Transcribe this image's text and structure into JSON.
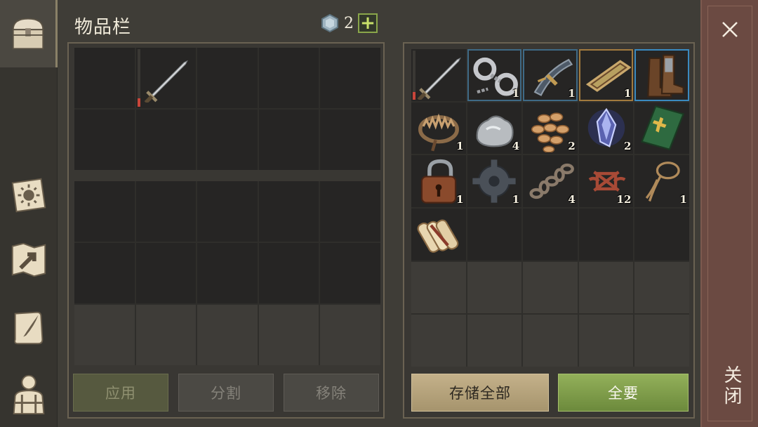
{
  "header": {
    "title": "物品栏",
    "currency_count": "2",
    "plus_label": "+"
  },
  "rail": {
    "tabs": [
      {
        "name": "chest-tab",
        "icon": "chest-icon"
      },
      {
        "name": "skills-tab",
        "icon": "sun-book-icon"
      },
      {
        "name": "map-tab",
        "icon": "map-arrow-icon"
      },
      {
        "name": "quest-tab",
        "icon": "quill-scroll-icon"
      },
      {
        "name": "character-tab",
        "icon": "character-icon"
      }
    ]
  },
  "storage": {
    "items": [
      {
        "icon": "sword-icon",
        "qty": "",
        "durability": 0.15,
        "frame": "none"
      },
      {
        "icon": "shackles-icon",
        "qty": "1",
        "frame": "blue"
      },
      {
        "icon": "crossbow-icon",
        "qty": "1",
        "frame": "blue"
      },
      {
        "icon": "stretcher-icon",
        "qty": "1",
        "frame": "gold"
      },
      {
        "icon": "boots-icon",
        "qty": "",
        "frame": "blue2"
      },
      {
        "icon": "bear-trap-icon",
        "qty": "1",
        "frame": "none"
      },
      {
        "icon": "stone-icon",
        "qty": "4",
        "frame": "none"
      },
      {
        "icon": "seeds-icon",
        "qty": "2",
        "frame": "none"
      },
      {
        "icon": "crystal-icon",
        "qty": "2",
        "frame": "none"
      },
      {
        "icon": "holy-book-icon",
        "qty": "",
        "frame": "none"
      },
      {
        "icon": "padlock-icon",
        "qty": "1",
        "frame": "none"
      },
      {
        "icon": "gear-icon",
        "qty": "1",
        "frame": "none"
      },
      {
        "icon": "chain-icon",
        "qty": "4",
        "frame": "none"
      },
      {
        "icon": "rope-knot-icon",
        "qty": "12",
        "frame": "none"
      },
      {
        "icon": "lasso-icon",
        "qty": "1",
        "frame": "none"
      },
      {
        "icon": "scroll-bundle-icon",
        "qty": "",
        "frame": "none"
      }
    ]
  },
  "inventory": {
    "items": [
      {
        "slot": 1,
        "icon": "sword-icon",
        "durability": 0.15
      }
    ]
  },
  "buttons": {
    "apply": "应用",
    "split": "分割",
    "remove": "移除",
    "store_all": "存储全部",
    "take_all": "全要"
  },
  "close": {
    "label": "关闭"
  },
  "colors": {
    "accent_green": "#8aa64a",
    "close_bg": "#6b4a42",
    "durability_low": "#c9453a",
    "durability_ok": "#c79a5c"
  }
}
